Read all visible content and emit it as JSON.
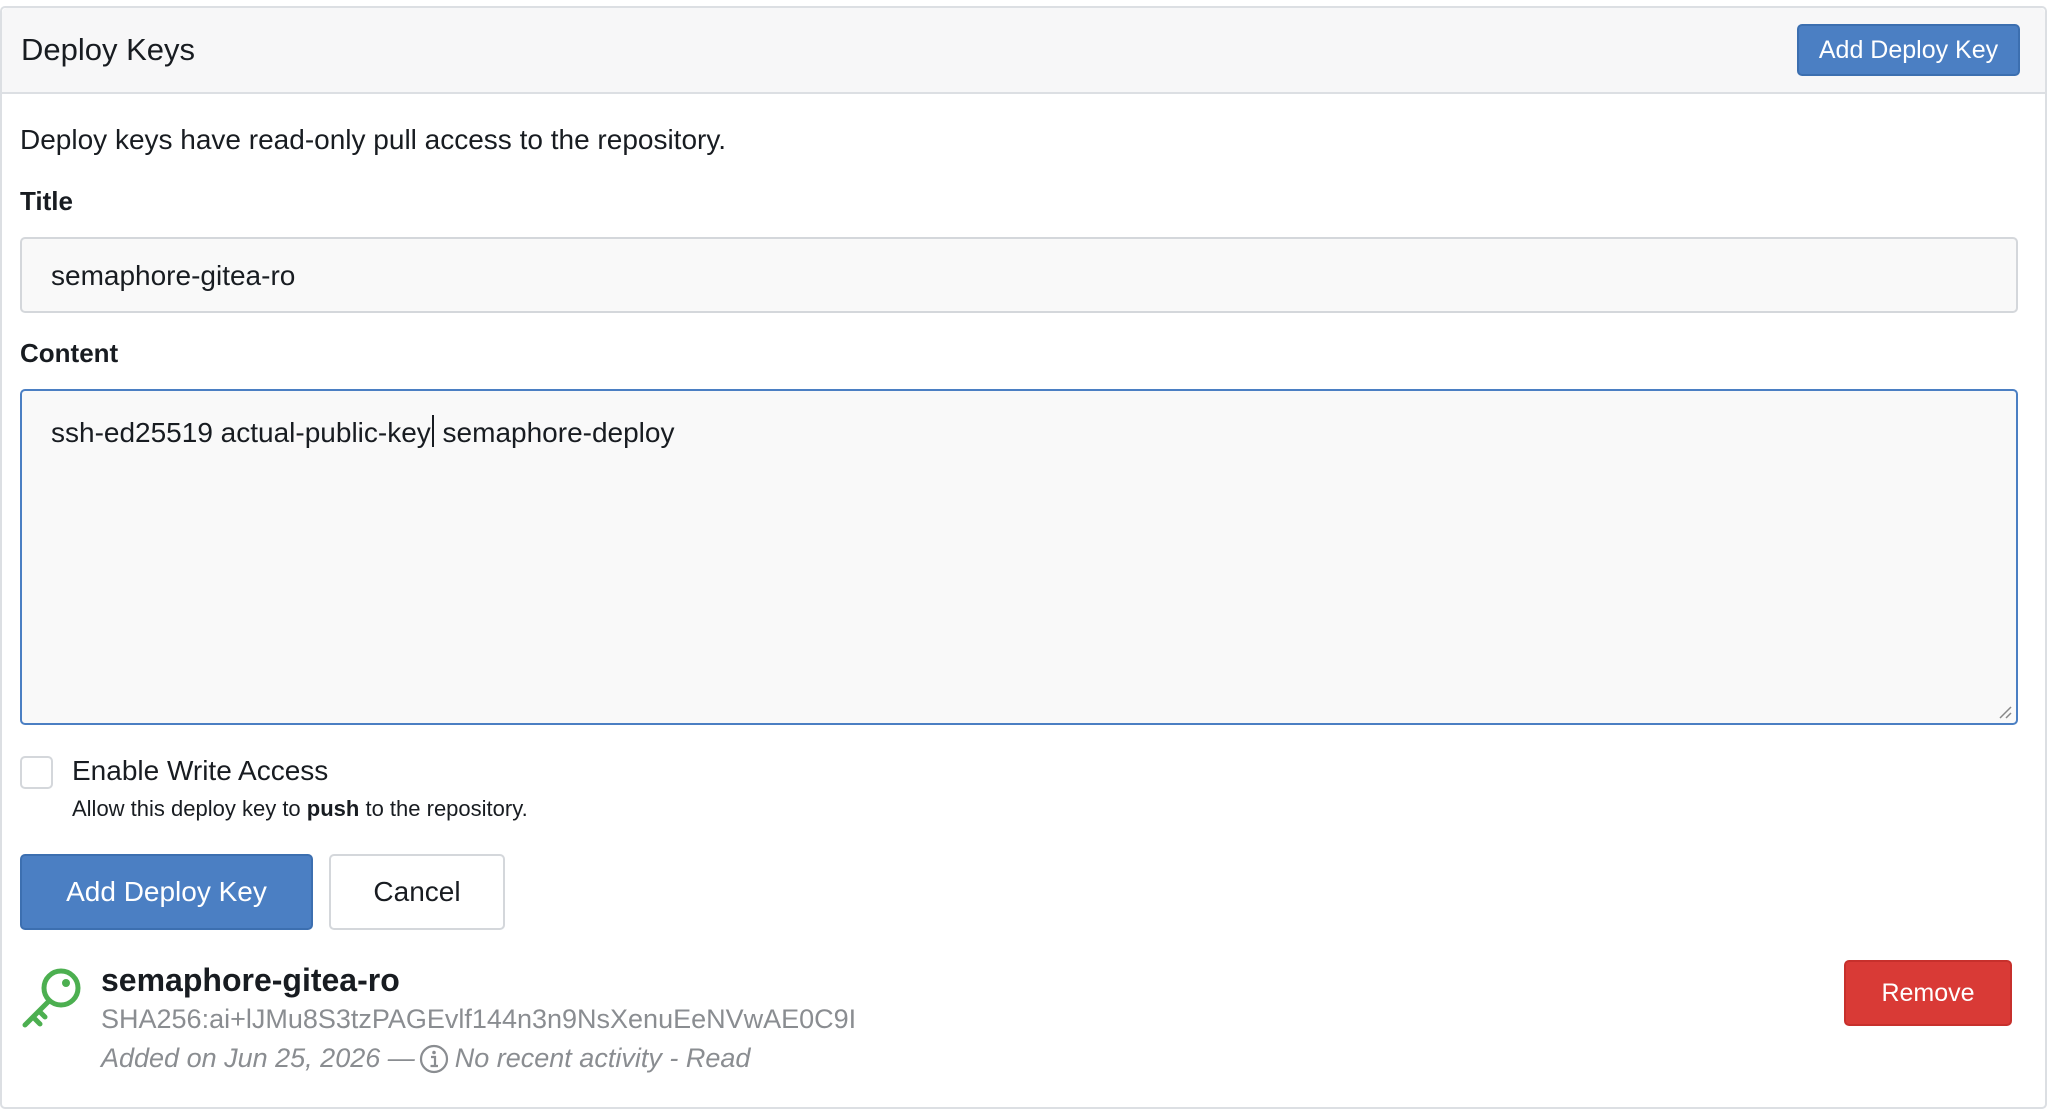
{
  "header": {
    "title": "Deploy Keys",
    "add_button": "Add Deploy Key"
  },
  "form": {
    "description": "Deploy keys have read-only pull access to the repository.",
    "title_label": "Title",
    "title_value": "semaphore-gitea-ro",
    "content_label": "Content",
    "content_before_caret": "ssh-ed25519 actual-public-key",
    "content_after_caret": " semaphore-deploy",
    "write_access": {
      "checked": false,
      "label": "Enable Write Access",
      "help_prefix": "Allow this deploy key to ",
      "help_bold": "push",
      "help_suffix": " to the repository."
    },
    "submit_label": "Add Deploy Key",
    "cancel_label": "Cancel"
  },
  "keys": [
    {
      "icon": "key-icon",
      "name": "semaphore-gitea-ro",
      "fingerprint": "SHA256:ai+lJMu8S3tzPAGEvlf144n3n9NsXenuEeNVwAE0C9I",
      "added": "Added on Jun 25, 2026 —",
      "activity": "No recent activity - Read",
      "remove_label": "Remove"
    }
  ],
  "colors": {
    "primary": "#4b7fc3",
    "danger": "#d93a36",
    "key_icon": "#4caf50",
    "muted": "#8a8d91"
  }
}
